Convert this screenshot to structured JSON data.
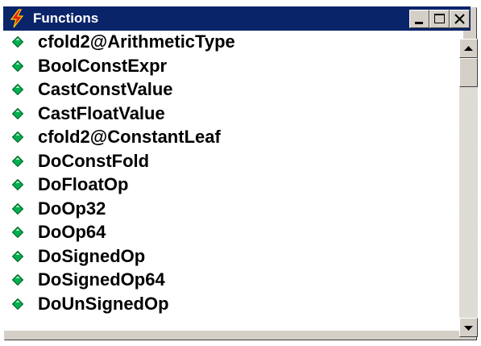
{
  "window": {
    "title": "Functions",
    "icon": "red-lightning-bolt-icon",
    "controls": {
      "minimize": "minimize-icon",
      "maximize": "maximize-icon",
      "close": "close-icon"
    }
  },
  "list": {
    "item_icon": "green-diamond-icon",
    "items": [
      {
        "label": "cfold2@ArithmeticType"
      },
      {
        "label": "BoolConstExpr"
      },
      {
        "label": "CastConstValue"
      },
      {
        "label": "CastFloatValue"
      },
      {
        "label": "cfold2@ConstantLeaf"
      },
      {
        "label": "DoConstFold"
      },
      {
        "label": "DoFloatOp"
      },
      {
        "label": "DoOp32"
      },
      {
        "label": "DoOp64"
      },
      {
        "label": "DoSignedOp"
      },
      {
        "label": "DoSignedOp64"
      },
      {
        "label": "DoUnSignedOp"
      }
    ]
  },
  "scrollbar": {
    "up": "scroll-up-arrow-icon",
    "down": "scroll-down-arrow-icon",
    "position_fraction": 0.0
  },
  "colors": {
    "titlebar": "#0a246a",
    "title_text": "#ffffff",
    "chrome": "#d4d0c8",
    "item_icon": "#00b050"
  }
}
